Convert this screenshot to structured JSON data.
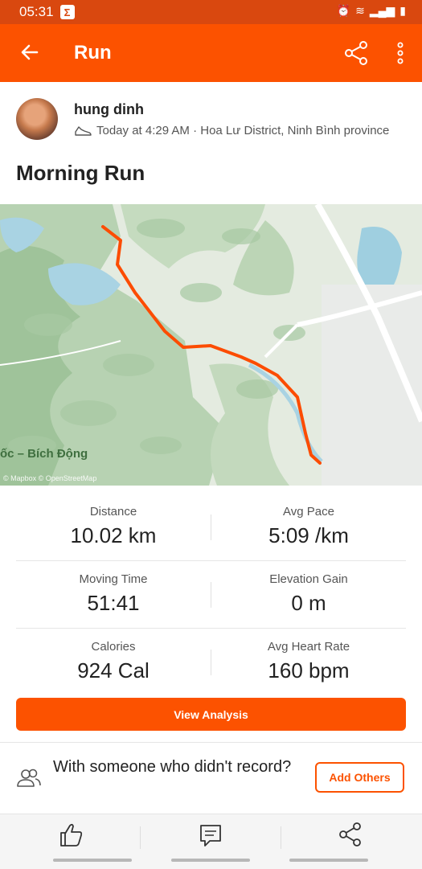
{
  "status": {
    "time": "05:31",
    "icon": "sigma-icon"
  },
  "appbar": {
    "title": "Run"
  },
  "activity": {
    "author": "hung dinh",
    "meta": "Today at 4:29 AM · Hoa Lư District, Ninh Bình province",
    "title": "Morning Run",
    "map_label": "ốc – Bích Động",
    "map_credit": "© Mapbox © OpenStreetMap"
  },
  "stats": [
    {
      "label": "Distance",
      "value": "10.02 km"
    },
    {
      "label": "Avg Pace",
      "value": "5:09 /km"
    },
    {
      "label": "Moving Time",
      "value": "51:41"
    },
    {
      "label": "Elevation Gain",
      "value": "0 m"
    },
    {
      "label": "Calories",
      "value": "924 Cal"
    },
    {
      "label": "Avg Heart Rate",
      "value": "160 bpm"
    }
  ],
  "actions": {
    "view_analysis": "View Analysis",
    "with_others": "With someone who didn't record?",
    "add_others": "Add Others"
  },
  "colors": {
    "accent": "#fc5200",
    "status_bar": "#d9480f"
  }
}
